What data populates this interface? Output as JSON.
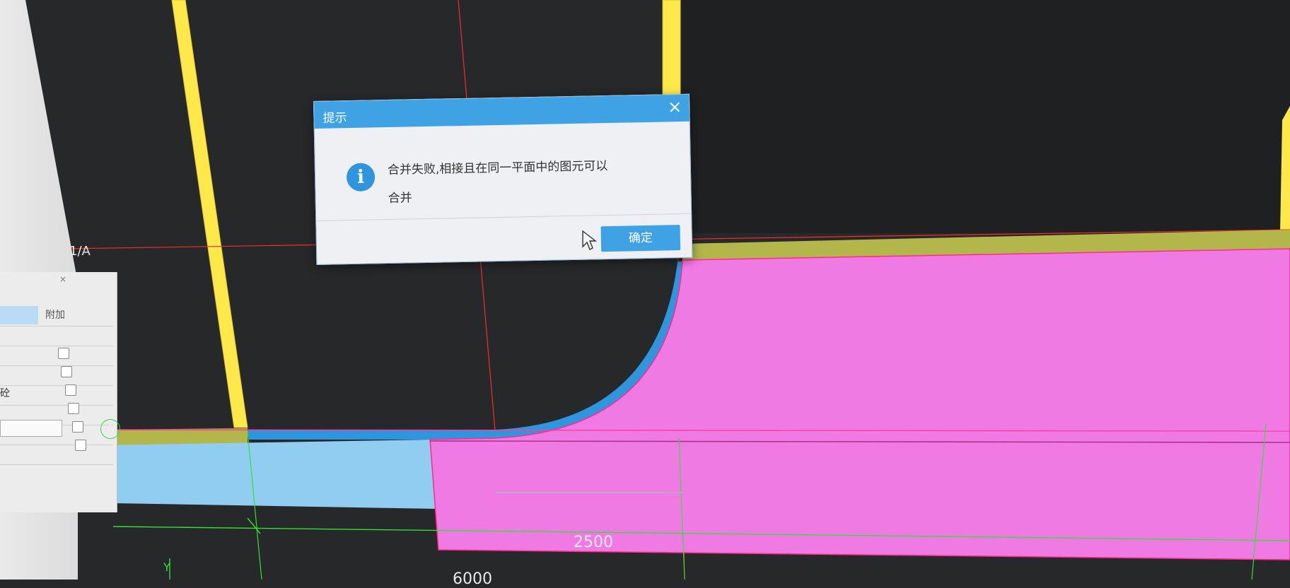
{
  "dialog": {
    "title": "提示",
    "close_glyph": "×",
    "message_line1": "合并失败,相接且在同一平面中的图元可以",
    "message_line2": "合并",
    "ok_label": "确定",
    "icon": "info-icon"
  },
  "axis_labels": {
    "grid_1A": "1/A",
    "grid_A": "A",
    "coord_y": "Y"
  },
  "dimensions": {
    "dim_2500": "2500",
    "dim_6000": "6000"
  },
  "property_panel": {
    "header_extra": "附加",
    "row_fragment": "砼",
    "close_glyph": "×"
  },
  "colors": {
    "canvas_bg": "#26282a",
    "wall_yellow": "#ffe84a",
    "slab_magenta": "#f07ae4",
    "slab_blue": "#90cdf0",
    "beam_blue": "#2f96dd",
    "olive_band": "#b3b64a",
    "grid_red": "#ff2a2a",
    "grid_green": "#33e033",
    "dialog_accent": "#3ea2e4"
  }
}
